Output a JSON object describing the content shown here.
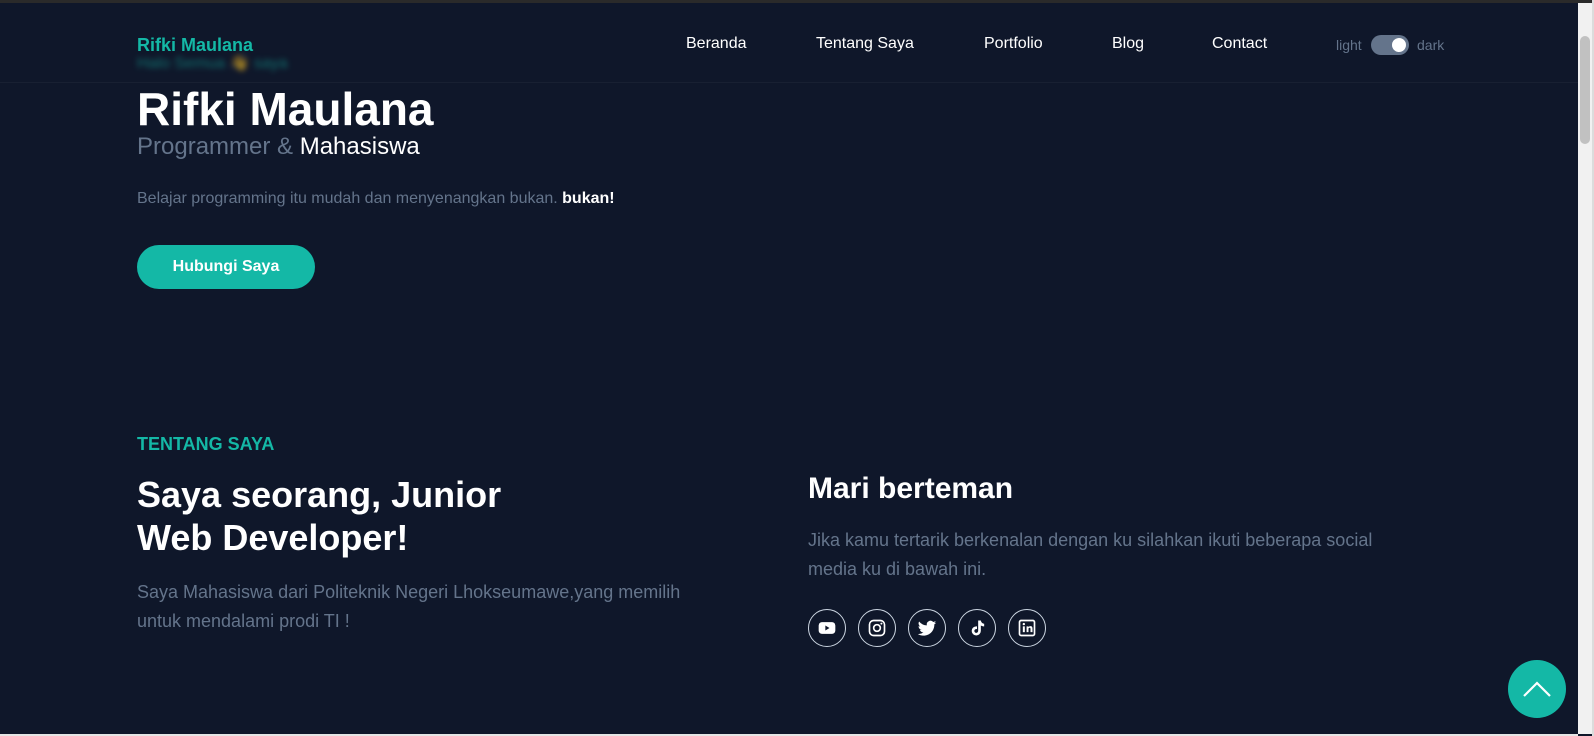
{
  "header": {
    "logo": "Rifki Maulana",
    "nav": [
      "Beranda",
      "Tentang Saya",
      "Portfolio",
      "Blog",
      "Contact"
    ],
    "theme_toggle": {
      "light_label": "light",
      "dark_label": "dark",
      "mode": "dark"
    }
  },
  "hero": {
    "greeting": "Halo Semua 👋 saya",
    "name": "Rifki Maulana",
    "role_prefix": "Programmer &",
    "role_highlight": "Mahasiswa",
    "description": "Belajar programming itu mudah dan menyenangkan bukan.",
    "description_emphasis": "bukan!",
    "cta_label": "Hubungi Saya"
  },
  "about": {
    "kicker": "TENTANG SAYA",
    "title": "Saya seorang, Junior Web Developer!",
    "body": "Saya Mahasiswa dari Politeknik Negeri Lhokseumawe,yang memilih untuk mendalami prodi TI !"
  },
  "social": {
    "title": "Mari berteman",
    "body": "Jika kamu tertarik berkenalan dengan ku silahkan ikuti beberapa social media ku di bawah ini.",
    "icons": [
      "youtube-icon",
      "instagram-icon",
      "twitter-icon",
      "tiktok-icon",
      "linkedin-icon"
    ]
  },
  "colors": {
    "background": "#0f172a",
    "primary": "#14b8a6",
    "muted": "#64748b",
    "text": "#ffffff"
  }
}
